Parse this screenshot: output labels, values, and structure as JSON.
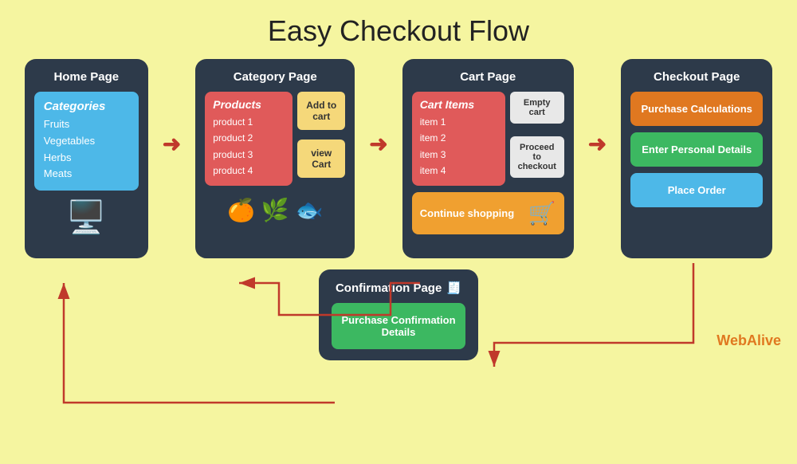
{
  "title": "Easy Checkout Flow",
  "home_page": {
    "title": "Home Page",
    "categories_title": "Categories",
    "categories": [
      "Fruits",
      "Vegetables",
      "Herbs",
      "Meats"
    ]
  },
  "category_page": {
    "title": "Category Page",
    "products_title": "Products",
    "products": [
      "product 1",
      "product 2",
      "product 3",
      "product 4"
    ],
    "btn_add_cart": "Add to cart",
    "btn_view_cart": "view Cart",
    "emojis": [
      "🍊",
      "🌿",
      "🐟"
    ]
  },
  "cart_page": {
    "title": "Cart Page",
    "cart_items_title": "Cart Items",
    "items": [
      "item 1",
      "item 2",
      "item 3",
      "item 4"
    ],
    "btn_empty": "Empty cart",
    "btn_proceed": "Proceed to checkout",
    "continue_shopping": "Continue shopping"
  },
  "checkout_page": {
    "title": "Checkout Page",
    "btn_purchase_calc": "Purchase Calculations",
    "btn_personal": "Enter Personal Details",
    "btn_place_order": "Place Order"
  },
  "confirmation_page": {
    "title": "Confirmation Page",
    "btn_confirmation": "Purchase Confirmation Details"
  },
  "branding": {
    "web": "Web",
    "alive": "Alive"
  }
}
